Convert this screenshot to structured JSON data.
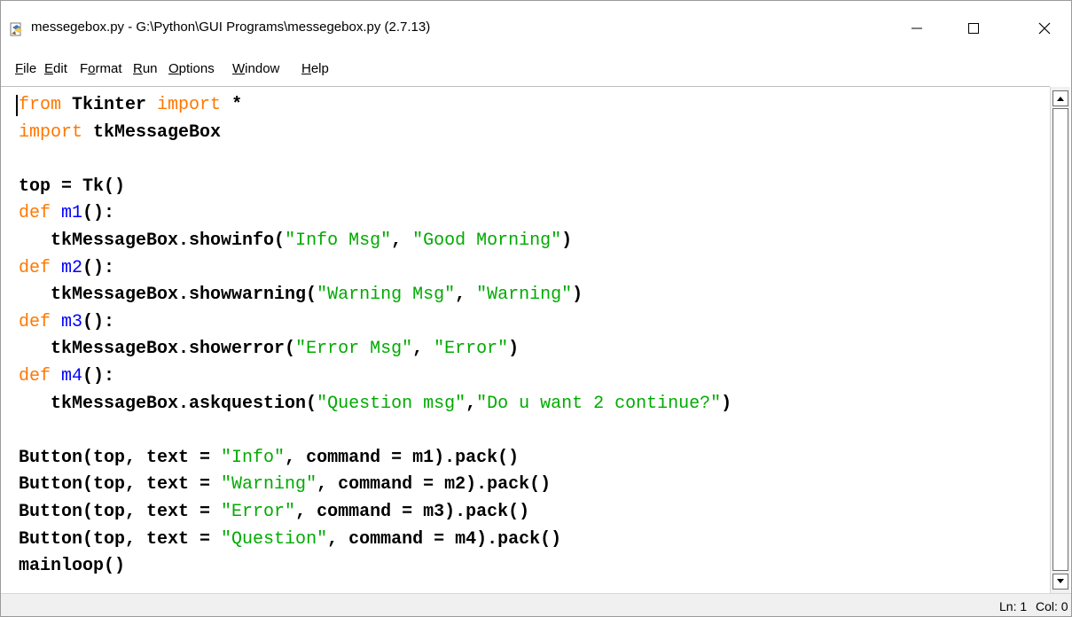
{
  "window": {
    "title": "messegebox.py - G:\\Python\\GUI Programs\\messegebox.py (2.7.13)",
    "icon": "python-file-icon",
    "controls": [
      "minimize-icon",
      "maximize-icon",
      "close-icon"
    ]
  },
  "menu": {
    "items": [
      {
        "key": "F",
        "rest": "ile"
      },
      {
        "key": "E",
        "rest": "dit"
      },
      {
        "pre": "F",
        "key": "o",
        "rest": "rmat"
      },
      {
        "key": "R",
        "rest": "un"
      },
      {
        "key": "O",
        "rest": "ptions"
      },
      {
        "key": "W",
        "rest": "indow"
      },
      {
        "key": "H",
        "rest": "elp"
      }
    ]
  },
  "editor": {
    "lines": [
      [
        {
          "t": "from",
          "c": "kw"
        },
        {
          "t": " Tkinter "
        },
        {
          "t": "import",
          "c": "kw"
        },
        {
          "t": " *"
        }
      ],
      [
        {
          "t": "import",
          "c": "kw"
        },
        {
          "t": " tkMessageBox"
        }
      ],
      [],
      [
        {
          "t": "top = Tk()"
        }
      ],
      [
        {
          "t": "def",
          "c": "kw"
        },
        {
          "t": " "
        },
        {
          "t": "m1",
          "c": "fn"
        },
        {
          "t": "():"
        }
      ],
      [
        {
          "t": "   tkMessageBox.showinfo("
        },
        {
          "t": "\"Info Msg\"",
          "c": "st"
        },
        {
          "t": ", "
        },
        {
          "t": "\"Good Morning\"",
          "c": "st"
        },
        {
          "t": ")"
        }
      ],
      [
        {
          "t": "def",
          "c": "kw"
        },
        {
          "t": " "
        },
        {
          "t": "m2",
          "c": "fn"
        },
        {
          "t": "():"
        }
      ],
      [
        {
          "t": "   tkMessageBox.showwarning("
        },
        {
          "t": "\"Warning Msg\"",
          "c": "st"
        },
        {
          "t": ", "
        },
        {
          "t": "\"Warning\"",
          "c": "st"
        },
        {
          "t": ")"
        }
      ],
      [
        {
          "t": "def",
          "c": "kw"
        },
        {
          "t": " "
        },
        {
          "t": "m3",
          "c": "fn"
        },
        {
          "t": "():"
        }
      ],
      [
        {
          "t": "   tkMessageBox.showerror("
        },
        {
          "t": "\"Error Msg\"",
          "c": "st"
        },
        {
          "t": ", "
        },
        {
          "t": "\"Error\"",
          "c": "st"
        },
        {
          "t": ")"
        }
      ],
      [
        {
          "t": "def",
          "c": "kw"
        },
        {
          "t": " "
        },
        {
          "t": "m4",
          "c": "fn"
        },
        {
          "t": "():"
        }
      ],
      [
        {
          "t": "   tkMessageBox.askquestion("
        },
        {
          "t": "\"Question msg\"",
          "c": "st"
        },
        {
          "t": ","
        },
        {
          "t": "\"Do u want 2 continue?\"",
          "c": "st"
        },
        {
          "t": ")"
        }
      ],
      [],
      [
        {
          "t": "Button(top, text = "
        },
        {
          "t": "\"Info\"",
          "c": "st"
        },
        {
          "t": ", command = m1).pack()"
        }
      ],
      [
        {
          "t": "Button(top, text = "
        },
        {
          "t": "\"Warning\"",
          "c": "st"
        },
        {
          "t": ", command = m2).pack()"
        }
      ],
      [
        {
          "t": "Button(top, text = "
        },
        {
          "t": "\"Error\"",
          "c": "st"
        },
        {
          "t": ", command = m3).pack()"
        }
      ],
      [
        {
          "t": "Button(top, text = "
        },
        {
          "t": "\"Question\"",
          "c": "st"
        },
        {
          "t": ", command = m4).pack()"
        }
      ],
      [
        {
          "t": "mainloop()"
        }
      ]
    ],
    "colors": {
      "keyword": "#ff7700",
      "definition": "#0000ff",
      "string": "#00aa00",
      "default": "#000000"
    }
  },
  "status": {
    "line": "Ln: 1",
    "col": "Col: 0"
  }
}
